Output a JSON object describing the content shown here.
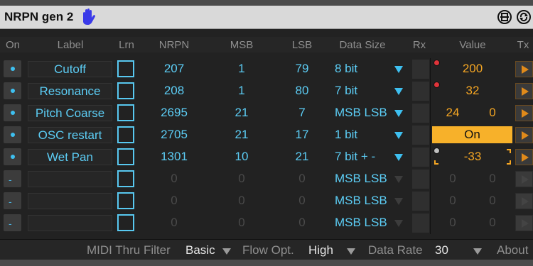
{
  "title": "NRPN gen 2",
  "icons": {
    "hand": "hand-icon",
    "pin": "pin-icon",
    "refresh": "refresh-icon"
  },
  "colors": {
    "accent_blue": "#5ccdf5",
    "value_orange": "#f5a623",
    "on_fill": "#f7b12a"
  },
  "headers": {
    "on": "On",
    "label": "Label",
    "lrn": "Lrn",
    "nrpn": "NRPN",
    "msb": "MSB",
    "lsb": "LSB",
    "data_size": "Data Size",
    "rx": "Rx",
    "value": "Value",
    "tx": "Tx"
  },
  "rows": [
    {
      "enabled": true,
      "label": "Cutoff",
      "nrpn": "207",
      "msb": "1",
      "lsb": "79",
      "data_size": "8 bit",
      "value": "200",
      "indicator": "red"
    },
    {
      "enabled": true,
      "label": "Resonance",
      "nrpn": "208",
      "msb": "1",
      "lsb": "80",
      "data_size": "7 bit",
      "value": "32",
      "indicator": "red"
    },
    {
      "enabled": true,
      "label": "Pitch Coarse",
      "nrpn": "2695",
      "msb": "21",
      "lsb": "7",
      "data_size": "MSB LSB",
      "value_msb": "24",
      "value_lsb": "0"
    },
    {
      "enabled": true,
      "label": "OSC restart",
      "nrpn": "2705",
      "msb": "21",
      "lsb": "17",
      "data_size": "1 bit",
      "value": "On"
    },
    {
      "enabled": true,
      "label": "Wet Pan",
      "nrpn": "1301",
      "msb": "10",
      "lsb": "21",
      "data_size": "7 bit + -",
      "value": "-33",
      "indicator": "grey"
    },
    {
      "enabled": false,
      "label": "",
      "nrpn": "0",
      "msb": "0",
      "lsb": "0",
      "data_size": "MSB LSB",
      "value_msb": "0",
      "value_lsb": "0"
    },
    {
      "enabled": false,
      "label": "",
      "nrpn": "0",
      "msb": "0",
      "lsb": "0",
      "data_size": "MSB LSB",
      "value_msb": "0",
      "value_lsb": "0"
    },
    {
      "enabled": false,
      "label": "",
      "nrpn": "0",
      "msb": "0",
      "lsb": "0",
      "data_size": "MSB LSB",
      "value_msb": "0",
      "value_lsb": "0"
    }
  ],
  "disabled_marker": "-",
  "footer": {
    "midi_thru_label": "MIDI Thru Filter",
    "midi_thru_value": "Basic",
    "flow_label": "Flow Opt.",
    "flow_value": "High",
    "rate_label": "Data Rate",
    "rate_value": "30",
    "about": "About"
  }
}
